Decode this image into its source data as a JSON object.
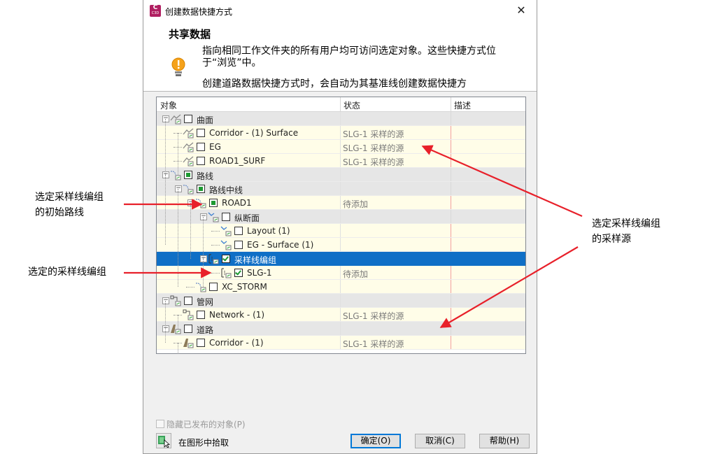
{
  "dialog": {
    "title": "创建数据快捷方式",
    "app_icon": {
      "letter": "C",
      "sub": "C3D",
      "color": "#b01f61"
    },
    "close_glyph": "✕",
    "section_title": "共享数据",
    "description_1": "指向相同工作文件夹的所有用户均可访问选定对象。这些快捷方式位于“浏览”中。",
    "description_2": "创建道路数据快捷方式时，会自动为其基准线创建数据快捷方",
    "info_icon": "lightbulb-icon"
  },
  "table": {
    "columns": [
      "对象",
      "状态",
      "描述"
    ],
    "rows": [
      {
        "name": "曲面",
        "status": "",
        "kind": "group",
        "icon": "surface-icon",
        "check": "none",
        "expander": "−"
      },
      {
        "name": "Corridor - (1) Surface",
        "status": "SLG-1 采样的源",
        "kind": "item",
        "icon": "surface-icon",
        "check": "none"
      },
      {
        "name": "EG",
        "status": "SLG-1 采样的源",
        "kind": "item",
        "icon": "surface-icon",
        "check": "none"
      },
      {
        "name": "ROAD1_SURF",
        "status": "SLG-1 采样的源",
        "kind": "item",
        "icon": "surface-icon",
        "check": "none"
      },
      {
        "name": "路线",
        "status": "",
        "kind": "group",
        "icon": "alignment-icon",
        "check": "partial",
        "expander": "−"
      },
      {
        "name": "路线中线",
        "status": "",
        "kind": "group",
        "icon": "alignment-icon",
        "check": "partial",
        "expander": "−"
      },
      {
        "name": "ROAD1",
        "status": "待添加",
        "kind": "item",
        "icon": "alignment-icon",
        "check": "partial",
        "expander": "−"
      },
      {
        "name": "纵断面",
        "status": "",
        "kind": "group",
        "icon": "profile-icon",
        "check": "none",
        "expander": "−"
      },
      {
        "name": "Layout (1)",
        "status": "",
        "kind": "item",
        "icon": "profile-icon",
        "check": "none"
      },
      {
        "name": "EG - Surface (1)",
        "status": "",
        "kind": "item",
        "icon": "profile-icon",
        "check": "none"
      },
      {
        "name": "采样线编组",
        "status": "",
        "kind": "selected",
        "icon": "sample-line-group-icon",
        "check": "checked",
        "expander": "−"
      },
      {
        "name": "SLG-1",
        "status": "待添加",
        "kind": "item",
        "icon": "sample-line-group-icon",
        "check": "checked"
      },
      {
        "name": "XC_STORM",
        "status": "",
        "kind": "item",
        "icon": "alignment-icon",
        "check": "none"
      },
      {
        "name": "管网",
        "status": "",
        "kind": "group",
        "icon": "pipe-network-icon",
        "check": "none",
        "expander": "−"
      },
      {
        "name": "Network - (1)",
        "status": "SLG-1 采样的源",
        "kind": "item",
        "icon": "pipe-network-icon",
        "check": "none"
      },
      {
        "name": "道路",
        "status": "",
        "kind": "group",
        "icon": "corridor-icon",
        "check": "none",
        "expander": "−"
      },
      {
        "name": "Corridor - (1)",
        "status": "SLG-1 采样的源",
        "kind": "item",
        "icon": "corridor-icon",
        "check": "none"
      }
    ]
  },
  "footer": {
    "hide_published": "隐藏已发布的对象(P)",
    "pick_from_drawing": "在图形中拾取",
    "ok": "确定(O)",
    "cancel": "取消(C)",
    "help": "帮助(H)"
  },
  "annotations": {
    "initial_alignment": [
      "选定采样线编组",
      "的初始路线"
    ],
    "selected_slg": "选定的采样线编组",
    "sample_sources": [
      "选定采样线编组",
      "的采样源"
    ]
  },
  "colors": {
    "selection": "#0f6fc6",
    "arrow": "#e8202a",
    "check_green": "#1e9a32"
  }
}
